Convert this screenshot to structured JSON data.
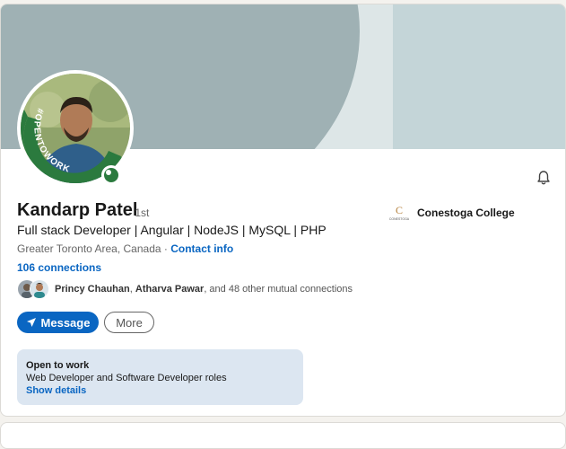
{
  "profile": {
    "name": "Kandarp Patel",
    "degree": "· 1st",
    "headline": "Full stack Developer | Angular | NodeJS | MySQL | PHP",
    "location": "Greater Toronto Area, Canada · ",
    "contact_info": "Contact info",
    "connections": "106 connections",
    "avatar_badge": "#OPENTOWORK"
  },
  "mutual": {
    "name1": "Princy Chauhan",
    "sep": ", ",
    "name2": "Atharva Pawar",
    "rest": ", and 48 other mutual connections"
  },
  "education": {
    "school": "Conestoga College",
    "logo_text": "CONESTOGA"
  },
  "actions": {
    "message": "Message",
    "more": "More"
  },
  "open_to_work": {
    "title": "Open to work",
    "roles": "Web Developer and Software Developer roles",
    "link": "Show details"
  },
  "colors": {
    "brand_blue": "#0a66c2",
    "open_to_work_green": "#2b7a3e",
    "otw_card_bg": "#dce6f1"
  },
  "icons": {
    "bell": "bell-icon",
    "send": "send-icon"
  }
}
